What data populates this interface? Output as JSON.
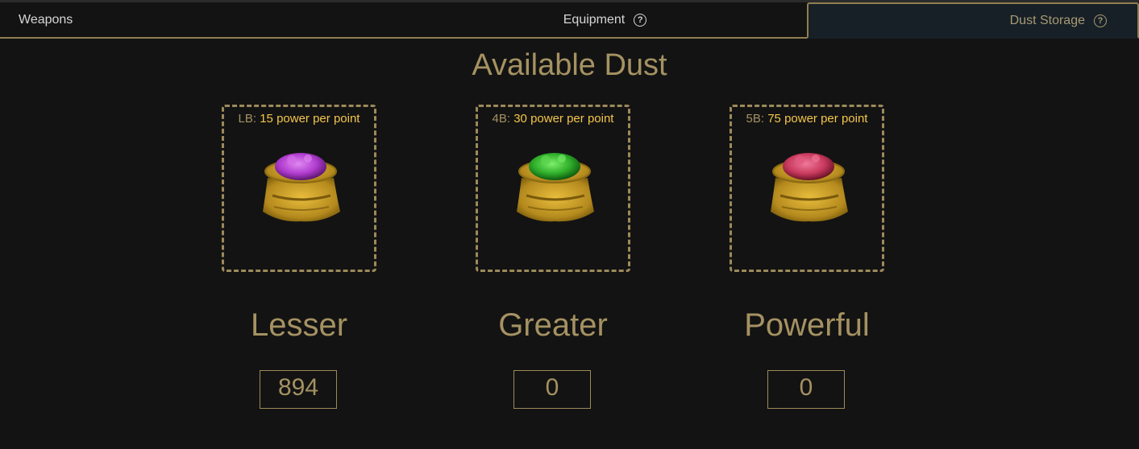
{
  "tabs": {
    "weapons": "Weapons",
    "equipment": "Equipment",
    "dust_storage": "Dust Storage",
    "help_glyph": "?"
  },
  "title": "Available Dust",
  "dust": [
    {
      "code": "LB:",
      "power": "15 power per point",
      "name": "Lesser",
      "count": "894",
      "color": "#b03ccf",
      "icon": "purple-dust-bag-icon"
    },
    {
      "code": "4B:",
      "power": "30 power per point",
      "name": "Greater",
      "count": "0",
      "color": "#2fae2a",
      "icon": "green-dust-bag-icon"
    },
    {
      "code": "5B:",
      "power": "75 power per point",
      "name": "Powerful",
      "count": "0",
      "color": "#c93a5e",
      "icon": "red-dust-bag-icon"
    }
  ],
  "colors": {
    "accent": "#a59262",
    "highlight": "#f3c64a",
    "background": "#131313",
    "active_tab": "#172026"
  }
}
